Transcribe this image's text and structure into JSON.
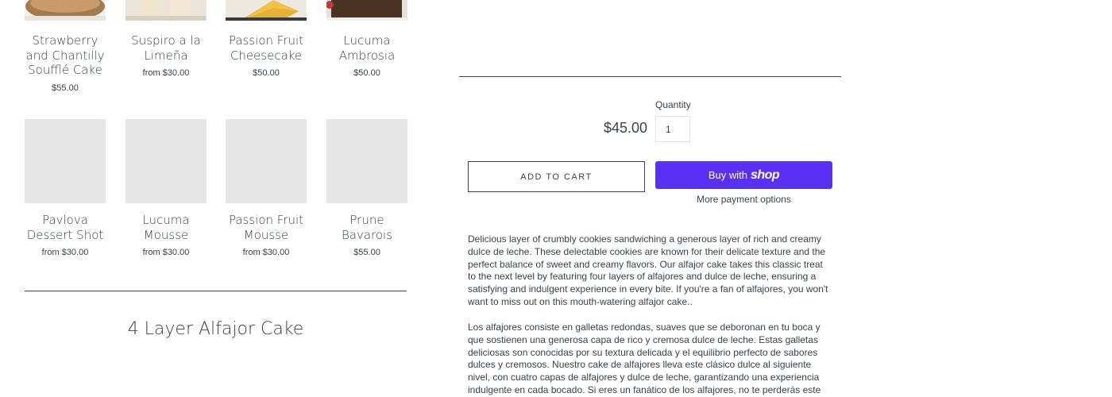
{
  "products_row1": [
    {
      "title": "Strawberry and Chantilly Soufflé Cake",
      "price": "$55.00",
      "image": "photo"
    },
    {
      "title": "Suspiro a la Limeña",
      "price": "from $30.00",
      "image": "photo"
    },
    {
      "title": "Passion Fruit Cheesecake",
      "price": "$50.00",
      "image": "photo"
    },
    {
      "title": "Lucuma Ambrosia",
      "price": "$50.00",
      "image": "photo"
    }
  ],
  "products_row2": [
    {
      "title": "Pavlova Dessert Shot",
      "price": "from $30.00",
      "image": "placeholder"
    },
    {
      "title": "Lucuma Mousse",
      "price": "from $30.00",
      "image": "placeholder"
    },
    {
      "title": "Passion Fruit Mousse",
      "price": "from $30.00",
      "image": "placeholder"
    },
    {
      "title": "Prune Bavarois",
      "price": "$55.00",
      "image": "placeholder"
    }
  ],
  "next_section": {
    "title": "4 Layer Alfajor Cake"
  },
  "product_form": {
    "price": "$45.00",
    "quantity_label": "Quantity",
    "quantity_value": "1",
    "add_to_cart_label": "Add to cart",
    "buy_with_prefix": "Buy with",
    "buy_with_brand": "shop",
    "more_payment_options": "More payment options"
  },
  "description": {
    "english": "Delicious layer of crumbly cookies sandwiching a generous layer of rich and creamy dulce de leche. These delectable cookies are known for their delicate texture and the perfect balance of sweet and creamy flavors. Our alfajor cake takes this classic treat to the next level by featuring four layers of alfajores and dulce de leche, ensuring a satisfying and indulgent experience in every bite. If you're a fan of alfajores, you won't want to miss out on this mouth-watering alfajor cake..",
    "spanish": "Los alfajores consiste en galletas redondas, suaves que se deboronan en tu boca y que sostienen una generosa capa de rico y cremosa dulce de leche. Estas galletas deliciosas son conocidas por su textura delicada y el equilibrio perfecto de sabores dulces y cremosos. Nuestro cake de alfajores lleva este clásico dulce al siguiente nivel, con cuatro capas de alfajores y dulce de leche, garantizando una experiencia indulgente en cada bocado. Si eres un fanático de los alfajores, no te perderás este bizcocho de alfajores que"
  },
  "colors": {
    "text": "#3d4246",
    "shop_pay": "#5a31f4",
    "placeholder": "#e6e6e6",
    "strawberry_cake": "#a37b4f",
    "suspiro": "#f0e3cc",
    "cheesecake": "#f1c24a",
    "ambrosia": "#4a3322"
  }
}
